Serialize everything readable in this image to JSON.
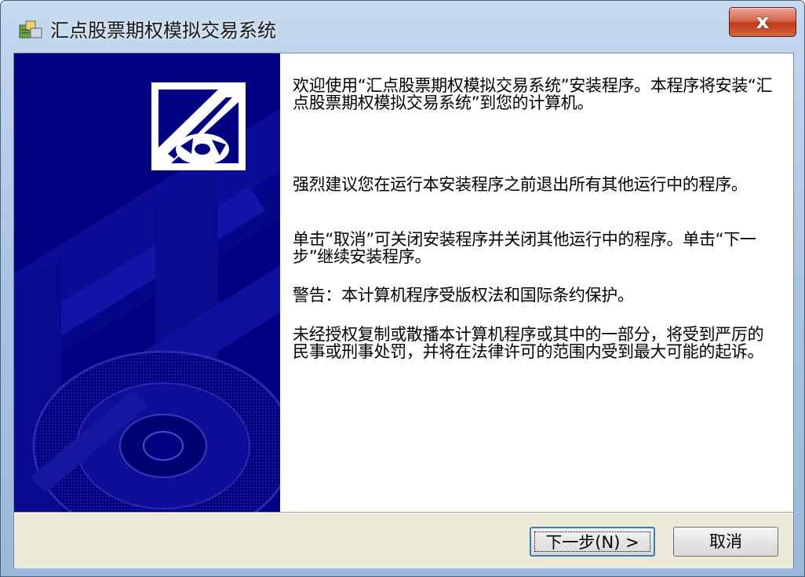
{
  "window": {
    "title": "汇点股票期权模拟交易系统",
    "close_glyph": "x"
  },
  "content": {
    "paragraphs": [
      "欢迎使用“汇点股票期权模拟交易系统”安装程序。本程序将安装“汇点股票期权模拟交易系统”到您的计算机。",
      "强烈建议您在运行本安装程序之前退出所有其他运行中的程序。",
      "单击“取消”可关闭安装程序并关闭其他运行中的程序。单击“下一步”继续安装程序。",
      "警告：本计算机程序受版权法和国际条约保护。",
      "未经授权复制或散播本计算机程序或其中的一部分，将受到严厉的民事或刑事处罚，并将在法律许可的范围内受到最大可能的起诉。"
    ]
  },
  "buttons": {
    "next_label": "下一步(N) >",
    "cancel_label": "取消"
  },
  "icons": {
    "app": "installer-icon",
    "sidebar": "installer-cd-artwork",
    "close": "close-icon"
  },
  "colors": {
    "sidebar_bg": "#000080",
    "close_button": "#c2391c",
    "dialog_bg": "#ffffff"
  }
}
